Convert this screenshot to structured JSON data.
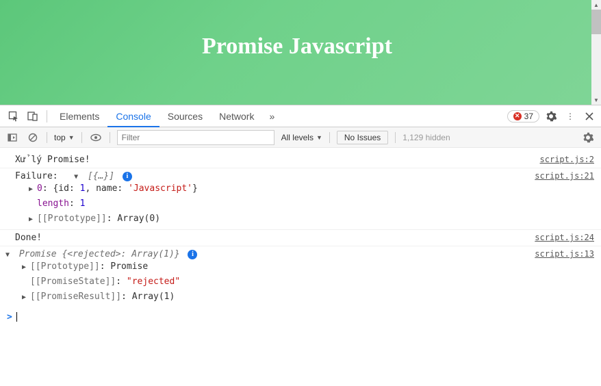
{
  "page": {
    "title": "Promise Javascript"
  },
  "tabs": {
    "items": [
      "Elements",
      "Console",
      "Sources",
      "Network"
    ],
    "active": 1,
    "more": "»",
    "errors": 37
  },
  "toolbar": {
    "context": "top",
    "filter_placeholder": "Filter",
    "levels": "All levels",
    "issues": "No Issues",
    "hidden": "1,129 hidden"
  },
  "console": {
    "rows": [
      {
        "text": "Xử lý Promise!",
        "src": "script.js:2"
      }
    ],
    "failure": {
      "label": "Failure:",
      "preview": "[{…}]",
      "src": "script.js:21",
      "item0_key": "0",
      "item0_val_open": "{id: ",
      "item0_id": "1",
      "item0_mid": ", name: ",
      "item0_name": "'Javascript'",
      "item0_close": "}",
      "length_key": "length",
      "length_val": "1",
      "proto_key": "[[Prototype]]",
      "proto_val": "Array(0)"
    },
    "done": {
      "text": "Done!",
      "src": "script.js:24"
    },
    "promise": {
      "preview_a": "Promise ",
      "preview_b": "{<rejected>: Array(1)}",
      "src": "script.js:13",
      "proto_key": "[[Prototype]]",
      "proto_val": "Promise",
      "state_key": "[[PromiseState]]",
      "state_val": "\"rejected\"",
      "result_key": "[[PromiseResult]]",
      "result_val": "Array(1)"
    },
    "prompt": ">"
  }
}
